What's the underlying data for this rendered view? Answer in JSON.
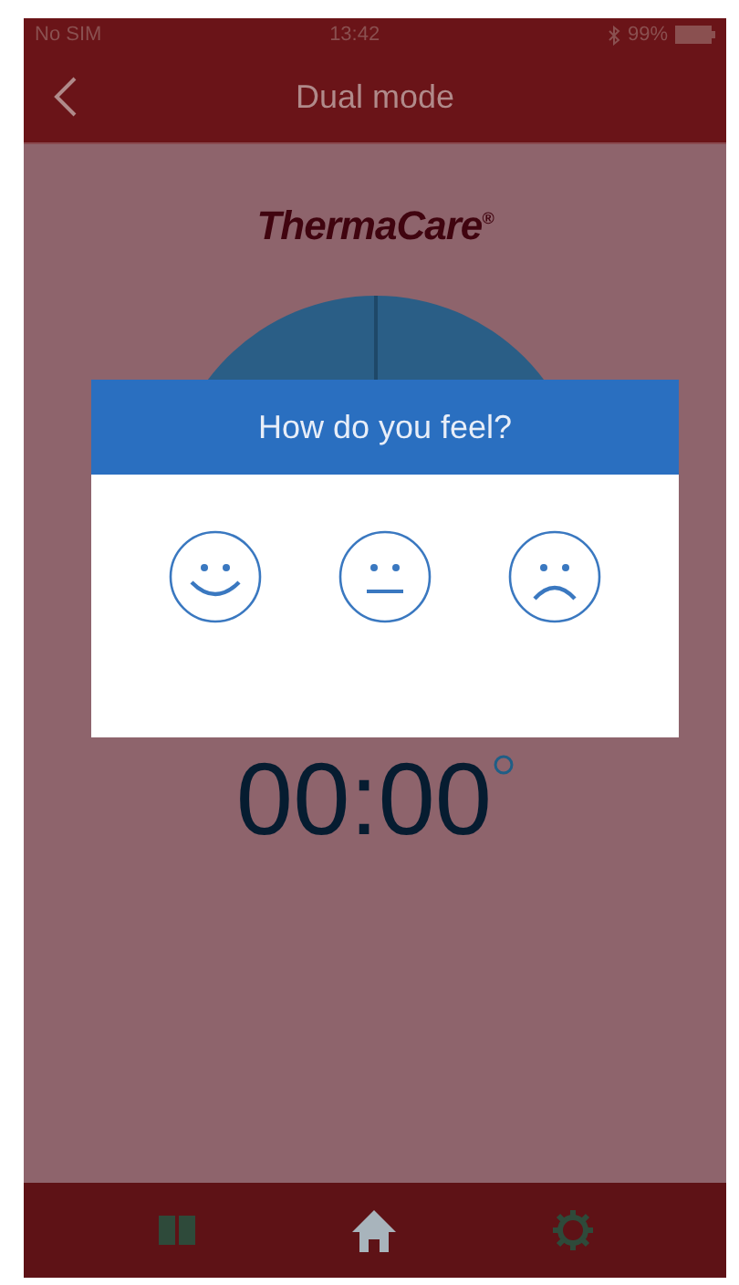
{
  "status_bar": {
    "carrier": "No SIM",
    "time": "13:42",
    "battery": "99%"
  },
  "nav_bar": {
    "title": "Dual mode"
  },
  "logo": {
    "text": "ThermaCare$^{®}$"
  },
  "timer": {
    "value": "00:00"
  },
  "dialog": {
    "title": "How do you feel?",
    "options": [
      {
        "kind": "happy",
        "selected": false
      },
      {
        "kind": "neutral",
        "selected": false
      },
      {
        "kind": "sad",
        "selected": false
      }
    ]
  },
  "tab_bar": {
    "items": [
      {
        "kind": "book",
        "selected": false
      },
      {
        "kind": "home",
        "selected": true
      },
      {
        "kind": "gear",
        "selected": false
      }
    ]
  }
}
